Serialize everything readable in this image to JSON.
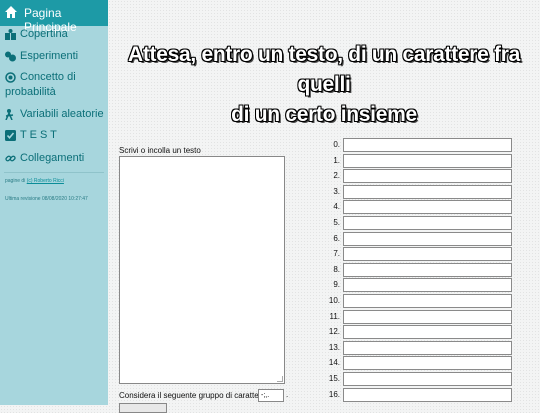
{
  "sidebar": {
    "home_label": "Pagina Principale",
    "items": [
      {
        "label": "Copertina",
        "icon": "cover-icon"
      },
      {
        "label": "Esperimenti",
        "icon": "experiments-icon"
      },
      {
        "label": "Concetto di",
        "label2": "probabilità",
        "icon": "concept-icon"
      },
      {
        "label": "Variabili aleatorie",
        "icon": "variables-icon"
      },
      {
        "label": "T E S T",
        "icon": "test-icon"
      },
      {
        "label": "Collegamenti",
        "icon": "link-icon"
      }
    ],
    "author_prefix": "pagine di ",
    "author_link": "(c) Roberto Ricci",
    "revision": "Ultima revisione 08/08/2020 10:27:47"
  },
  "page": {
    "title_line1": "Attesa, entro un testo, di un carattere fra quelli",
    "title_line2": "di un certo insieme"
  },
  "form": {
    "textarea_label": "Scrivi o incolla un testo",
    "textarea_value": "",
    "group_label": "Considera il seguente gruppo di caratteri:",
    "group_value": "-;,.",
    "group_suffix": "."
  },
  "results": {
    "row_labels": [
      "0.",
      "1.",
      "2.",
      "3.",
      "4.",
      "5.",
      "6.",
      "7.",
      "8.",
      "9.",
      "10.",
      "11.",
      "12.",
      "13.",
      "14.",
      "15.",
      "16."
    ],
    "row_values": [
      "",
      "",
      "",
      "",
      "",
      "",
      "",
      "",
      "",
      "",
      "",
      "",
      "",
      "",
      "",
      "",
      ""
    ]
  },
  "colors": {
    "sidebar_bg": "#a7d6dd",
    "home_bg": "#1d9aa6",
    "nav_text": "#0b6f78"
  }
}
